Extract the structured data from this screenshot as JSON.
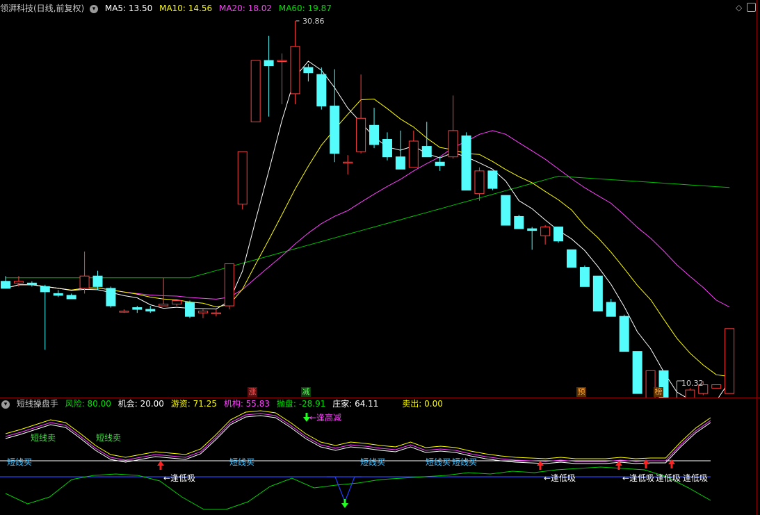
{
  "header": {
    "title": "领湃科技(日线,前复权)",
    "ma": [
      {
        "label": "MA5: 13.50",
        "color": "#ffffff"
      },
      {
        "label": "MA10: 14.56",
        "color": "#ffff00"
      },
      {
        "label": "MA20: 18.02",
        "color": "#ff40ff"
      },
      {
        "label": "MA60: 19.87",
        "color": "#00e000"
      }
    ],
    "icons": [
      "diamond-icon",
      "expand-icon"
    ]
  },
  "main_chart": {
    "high_label": "30.86",
    "low_label": "10.32",
    "tags": [
      {
        "text": "涨",
        "color": "#ff5050"
      },
      {
        "text": "减",
        "color": "#50ff50"
      },
      {
        "text": "预",
        "color": "#ffaa40"
      },
      {
        "text": "榜",
        "color": "#ffaa40"
      }
    ]
  },
  "indicator": {
    "title": "短线操盘手",
    "values": [
      {
        "label": "风险: 80.00",
        "color": "#00e000"
      },
      {
        "label": "机会: 20.00",
        "color": "#ffffff"
      },
      {
        "label": "游资: 71.25",
        "color": "#ffff00"
      },
      {
        "label": "机构: 55.83",
        "color": "#ff40ff"
      },
      {
        "label": "抛盘: -28.91",
        "color": "#00e000"
      },
      {
        "label": "庄家: 64.11",
        "color": "#ffffff"
      },
      {
        "label": "卖出: 0.00",
        "color": "#ffff00"
      }
    ],
    "signals": {
      "sell": [
        "短线卖",
        "短线卖"
      ],
      "buy": [
        "短线买",
        "短线买",
        "短线买",
        "短线买",
        "短线买"
      ],
      "low_buy": [
        "←逢低吸",
        "←逢低吸",
        "←逢低吸",
        "逢低吸",
        "逢低吸"
      ],
      "high_sell": "←逢高减"
    }
  },
  "chart_data": {
    "type": "candlestick",
    "title": "",
    "candles": [
      {
        "o": 16.0,
        "h": 16.3,
        "l": 15.6,
        "c": 15.6
      },
      {
        "o": 15.9,
        "h": 16.3,
        "l": 15.7,
        "c": 16.0
      },
      {
        "o": 15.9,
        "h": 16.0,
        "l": 15.7,
        "c": 15.8
      },
      {
        "o": 15.7,
        "h": 15.8,
        "l": 12.1,
        "c": 15.4
      },
      {
        "o": 15.3,
        "h": 15.5,
        "l": 15.1,
        "c": 15.2
      },
      {
        "o": 15.2,
        "h": 15.3,
        "l": 15.0,
        "c": 15.0
      },
      {
        "o": 15.6,
        "h": 17.7,
        "l": 15.3,
        "c": 16.3
      },
      {
        "o": 16.3,
        "h": 16.6,
        "l": 15.5,
        "c": 15.7
      },
      {
        "o": 15.6,
        "h": 15.7,
        "l": 14.5,
        "c": 14.6
      },
      {
        "o": 14.3,
        "h": 14.4,
        "l": 14.2,
        "c": 14.3
      },
      {
        "o": 14.5,
        "h": 14.6,
        "l": 14.2,
        "c": 14.4
      },
      {
        "o": 14.4,
        "h": 14.6,
        "l": 14.2,
        "c": 14.3
      },
      {
        "o": 14.6,
        "h": 16.2,
        "l": 14.6,
        "c": 14.7
      },
      {
        "o": 14.7,
        "h": 14.9,
        "l": 14.6,
        "c": 14.9
      },
      {
        "o": 14.8,
        "h": 14.9,
        "l": 13.9,
        "c": 14.0
      },
      {
        "o": 14.2,
        "h": 14.4,
        "l": 13.9,
        "c": 14.3
      },
      {
        "o": 14.2,
        "h": 14.4,
        "l": 14.0,
        "c": 14.2
      },
      {
        "o": 14.6,
        "h": 17.0,
        "l": 14.4,
        "c": 17.0
      },
      {
        "o": 20.4,
        "h": 23.4,
        "l": 20.1,
        "c": 23.4
      },
      {
        "o": 25.1,
        "h": 28.6,
        "l": 25.1,
        "c": 28.6
      },
      {
        "o": 28.6,
        "h": 30.0,
        "l": 25.4,
        "c": 28.3
      },
      {
        "o": 28.6,
        "h": 29.0,
        "l": 26.1,
        "c": 28.6
      },
      {
        "o": 26.7,
        "h": 30.86,
        "l": 26.1,
        "c": 29.4
      },
      {
        "o": 28.2,
        "h": 28.4,
        "l": 27.4,
        "c": 27.9
      },
      {
        "o": 27.8,
        "h": 28.2,
        "l": 25.8,
        "c": 26.0
      },
      {
        "o": 26.0,
        "h": 28.1,
        "l": 22.8,
        "c": 23.3
      },
      {
        "o": 22.8,
        "h": 23.2,
        "l": 22.1,
        "c": 22.8
      },
      {
        "o": 23.4,
        "h": 27.8,
        "l": 23.3,
        "c": 25.3
      },
      {
        "o": 24.9,
        "h": 25.9,
        "l": 23.6,
        "c": 23.8
      },
      {
        "o": 24.1,
        "h": 24.5,
        "l": 22.9,
        "c": 23.1
      },
      {
        "o": 23.1,
        "h": 24.6,
        "l": 22.4,
        "c": 22.4
      },
      {
        "o": 22.5,
        "h": 24.6,
        "l": 22.5,
        "c": 24.0
      },
      {
        "o": 23.7,
        "h": 25.1,
        "l": 23.1,
        "c": 23.1
      },
      {
        "o": 22.8,
        "h": 23.1,
        "l": 22.3,
        "c": 22.6
      },
      {
        "o": 23.1,
        "h": 26.6,
        "l": 23.0,
        "c": 24.6
      },
      {
        "o": 24.3,
        "h": 24.5,
        "l": 21.2,
        "c": 21.2
      },
      {
        "o": 21.0,
        "h": 22.5,
        "l": 20.6,
        "c": 22.3
      },
      {
        "o": 22.3,
        "h": 22.3,
        "l": 21.2,
        "c": 21.3
      },
      {
        "o": 20.9,
        "h": 20.9,
        "l": 19.2,
        "c": 19.2
      },
      {
        "o": 19.7,
        "h": 19.8,
        "l": 19.0,
        "c": 19.0
      },
      {
        "o": 19.0,
        "h": 19.1,
        "l": 17.8,
        "c": 18.9
      },
      {
        "o": 18.6,
        "h": 19.2,
        "l": 18.1,
        "c": 19.1
      },
      {
        "o": 19.1,
        "h": 19.1,
        "l": 18.2,
        "c": 18.3
      },
      {
        "o": 17.8,
        "h": 17.8,
        "l": 16.8,
        "c": 16.8
      },
      {
        "o": 16.8,
        "h": 16.9,
        "l": 15.7,
        "c": 15.7
      },
      {
        "o": 16.3,
        "h": 16.3,
        "l": 14.3,
        "c": 14.3
      },
      {
        "o": 14.8,
        "h": 15.0,
        "l": 14.0,
        "c": 14.0
      },
      {
        "o": 14.0,
        "h": 14.1,
        "l": 12.0,
        "c": 12.0
      },
      {
        "o": 12.0,
        "h": 12.0,
        "l": 9.6,
        "c": 9.6
      },
      {
        "o": 9.1,
        "h": 9.9,
        "l": 7.8,
        "c": 10.9
      },
      {
        "o": 10.9,
        "h": 10.9,
        "l": 7.7,
        "c": 7.7
      },
      {
        "o": 7.6,
        "h": 8.3,
        "l": 6.4,
        "c": 8.2
      },
      {
        "o": 8.4,
        "h": 9.9,
        "l": 8.2,
        "c": 9.8
      },
      {
        "o": 9.6,
        "h": 10.3,
        "l": 9.5,
        "c": 10.1
      },
      {
        "o": 9.9,
        "h": 10.1,
        "l": 9.9,
        "c": 10.1
      },
      {
        "o": 9.6,
        "h": 13.3,
        "l": 9.6,
        "c": 13.3
      }
    ]
  },
  "colors": {
    "up": "#ff4040",
    "down": "#54fcfc",
    "ma5": "#ffffff",
    "ma10": "#ffff00",
    "ma20": "#ff40ff",
    "ma60": "#00c000"
  }
}
